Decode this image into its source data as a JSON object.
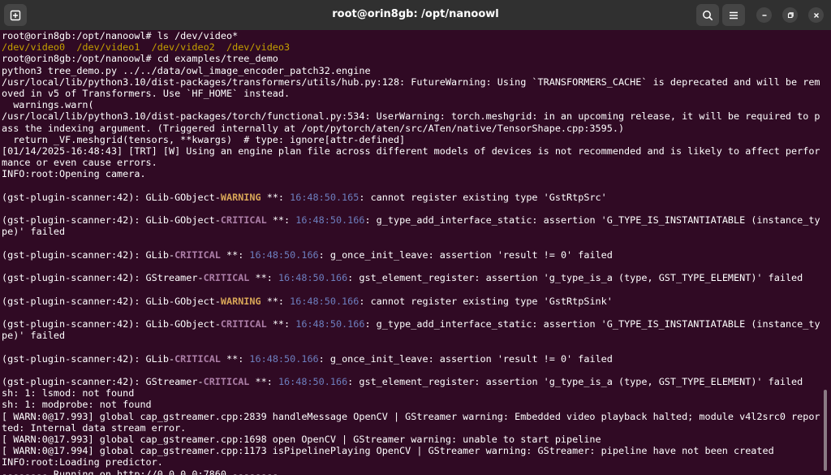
{
  "window": {
    "title": "root@orin8gb: /opt/nanoowl"
  },
  "icons": {
    "new_tab": "new-tab-icon",
    "search": "search-icon",
    "menu": "hamburger-menu-icon",
    "minimize": "minimize-icon",
    "restore": "restore-icon",
    "close": "close-icon"
  },
  "colors": {
    "background": "#300a24",
    "titlebar": "#303030",
    "text": "#ffffff",
    "dir_yellow": "#c4a000",
    "warning": "#d8a657",
    "critical": "#ad7fa8",
    "timestamp": "#6d7fbf"
  },
  "terminal": {
    "lines": [
      [
        "root@orin8gb:/opt/nanoowl# ls /dev/video*"
      ],
      [
        "/dev/video0  /dev/video1  /dev/video2  /dev/video3"
      ],
      [
        "root@orin8gb:/opt/nanoowl# cd examples/tree_demo"
      ],
      [
        "python3 tree_demo.py ../../data/owl_image_encoder_patch32.engine"
      ],
      [
        "/usr/local/lib/python3.10/dist-packages/transformers/utils/hub.py:128: FutureWarning: Using `TRANSFORMERS_CACHE` is deprecated and will be rem"
      ],
      [
        "oved in v5 of Transformers. Use `HF_HOME` instead."
      ],
      [
        "  warnings.warn("
      ],
      [
        "/usr/local/lib/python3.10/dist-packages/torch/functional.py:534: UserWarning: torch.meshgrid: in an upcoming release, it will be required to p"
      ],
      [
        "ass the indexing argument. (Triggered internally at /opt/pytorch/aten/src/ATen/native/TensorShape.cpp:3595.)"
      ],
      [
        "  return _VF.meshgrid(tensors, **kwargs)  # type: ignore[attr-defined]"
      ],
      [
        "[01/14/2025-16:48:43] [TRT] [W] Using an engine plan file across different models of devices is not recommended and is likely to affect perfor"
      ],
      [
        "mance or even cause errors."
      ],
      [
        "INFO:root:Opening camera."
      ],
      [
        ""
      ],
      [
        "(gst-plugin-scanner:42): GLib-GObject-",
        "WARNING",
        " **: ",
        "16:48:50.165",
        ": cannot register existing type 'GstRtpSrc'"
      ],
      [
        ""
      ],
      [
        "(gst-plugin-scanner:42): GLib-GObject-",
        "CRITICAL",
        " **: ",
        "16:48:50.166",
        ": g_type_add_interface_static: assertion 'G_TYPE_IS_INSTANTIATABLE (instance_ty"
      ],
      [
        "pe)' failed"
      ],
      [
        ""
      ],
      [
        "(gst-plugin-scanner:42): GLib-",
        "CRITICAL",
        " **: ",
        "16:48:50.166",
        ": g_once_init_leave: assertion 'result != 0' failed"
      ],
      [
        ""
      ],
      [
        "(gst-plugin-scanner:42): GStreamer-",
        "CRITICAL",
        " **: ",
        "16:48:50.166",
        ": gst_element_register: assertion 'g_type_is_a (type, GST_TYPE_ELEMENT)' failed"
      ],
      [
        ""
      ],
      [
        "(gst-plugin-scanner:42): GLib-GObject-",
        "WARNING",
        " **: ",
        "16:48:50.166",
        ": cannot register existing type 'GstRtpSink'"
      ],
      [
        ""
      ],
      [
        "(gst-plugin-scanner:42): GLib-GObject-",
        "CRITICAL",
        " **: ",
        "16:48:50.166",
        ": g_type_add_interface_static: assertion 'G_TYPE_IS_INSTANTIATABLE (instance_ty"
      ],
      [
        "pe)' failed"
      ],
      [
        ""
      ],
      [
        "(gst-plugin-scanner:42): GLib-",
        "CRITICAL",
        " **: ",
        "16:48:50.166",
        ": g_once_init_leave: assertion 'result != 0' failed"
      ],
      [
        ""
      ],
      [
        "(gst-plugin-scanner:42): GStreamer-",
        "CRITICAL",
        " **: ",
        "16:48:50.166",
        ": gst_element_register: assertion 'g_type_is_a (type, GST_TYPE_ELEMENT)' failed"
      ],
      [
        "sh: 1: lsmod: not found"
      ],
      [
        "sh: 1: modprobe: not found"
      ],
      [
        "[ WARN:0@17.993] global cap_gstreamer.cpp:2839 handleMessage OpenCV | GStreamer warning: Embedded video playback halted; module v4l2src0 repor"
      ],
      [
        "ted: Internal data stream error."
      ],
      [
        "[ WARN:0@17.993] global cap_gstreamer.cpp:1698 open OpenCV | GStreamer warning: unable to start pipeline"
      ],
      [
        "[ WARN:0@17.994] global cap_gstreamer.cpp:1173 isPipelinePlaying OpenCV | GStreamer warning: GStreamer: pipeline have not been created"
      ],
      [
        "INFO:root:Loading predictor."
      ],
      [
        "-------- Running on http://0.0.0.0:7860 --------"
      ]
    ]
  }
}
